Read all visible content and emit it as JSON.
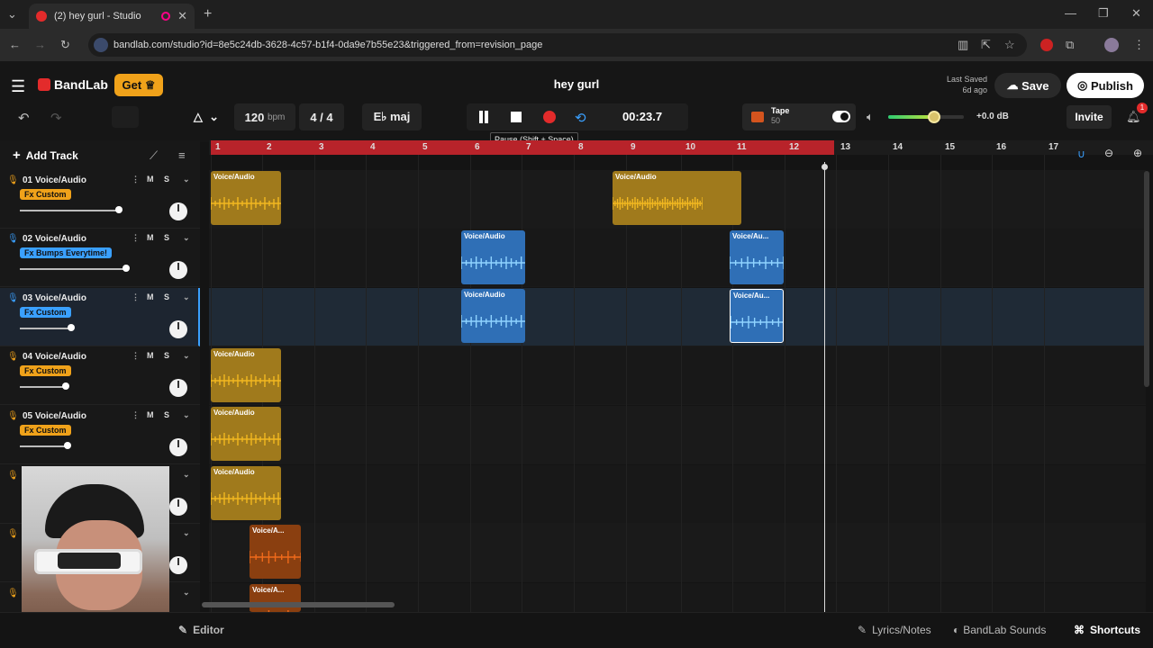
{
  "browser": {
    "tab_title": "(2) hey gurl - Studio",
    "url": "bandlab.com/studio?id=8e5c24db-3628-4c57-b1f4-0da9e7b55e23&triggered_from=revision_page"
  },
  "header": {
    "brand": "BandLab",
    "get_label": "Get",
    "project_title": "hey gurl",
    "last_saved_label": "Last Saved",
    "last_saved_value": "6d ago",
    "save_label": "Save",
    "publish_label": "Publish"
  },
  "transport": {
    "tempo": "120",
    "tempo_unit": "bpm",
    "time_signature": "4 / 4",
    "key": "E♭ maj",
    "time": "00:23.7",
    "tooltip": "Pause (Shift + Space)",
    "tape_label": "Tape",
    "tape_value": "50",
    "gain": "+0.0 dB",
    "invite_label": "Invite",
    "notification_count": "1"
  },
  "toolbar": {
    "add_track_label": "Add Track"
  },
  "ruler": {
    "bars": [
      "1",
      "2",
      "3",
      "4",
      "5",
      "6",
      "7",
      "8",
      "9",
      "10",
      "11",
      "12",
      "13",
      "14",
      "15",
      "16",
      "17"
    ]
  },
  "tracks": [
    {
      "name": "01 Voice/Audio",
      "fx": "Fx Custom",
      "volume": 0.5
    },
    {
      "name": "02 Voice/Audio",
      "fx": "Fx Bumps Everytime!",
      "volume": 0.6
    },
    {
      "name": "03 Voice/Audio",
      "fx": "Fx Custom",
      "volume": 0.26
    },
    {
      "name": "04 Voice/Audio",
      "fx": "Fx Custom",
      "volume": 0.23
    },
    {
      "name": "05 Voice/Audio",
      "fx": "Fx Custom",
      "volume": 0.24
    }
  ],
  "clip_labels": {
    "full": "Voice/Audio",
    "short": "Voice/Au...",
    "tiny": "Voice/A..."
  },
  "footer": {
    "editor_label": "Editor",
    "lyrics_label": "Lyrics/Notes",
    "sounds_label": "BandLab Sounds",
    "shortcuts_label": "Shortcuts"
  },
  "colors": {
    "accent_red": "#e32b2b",
    "clip_gold": "#a07a1c",
    "clip_blue": "#2f6fb6",
    "fx_gold": "#f0a21a",
    "fx_blue": "#3aa0ff"
  }
}
